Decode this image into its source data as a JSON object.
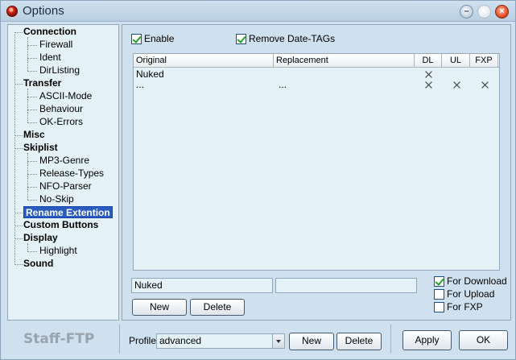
{
  "window": {
    "title": "Options"
  },
  "tree": {
    "items": [
      {
        "label": "Connection",
        "level": 0
      },
      {
        "label": "Firewall",
        "level": 1
      },
      {
        "label": "Ident",
        "level": 1
      },
      {
        "label": "DirListing",
        "level": 1
      },
      {
        "label": "Transfer",
        "level": 0
      },
      {
        "label": "ASCII-Mode",
        "level": 1
      },
      {
        "label": "Behaviour",
        "level": 1
      },
      {
        "label": "OK-Errors",
        "level": 1
      },
      {
        "label": "Misc",
        "level": 0
      },
      {
        "label": "Skiplist",
        "level": 0
      },
      {
        "label": "MP3-Genre",
        "level": 1
      },
      {
        "label": "Release-Types",
        "level": 1
      },
      {
        "label": "NFO-Parser",
        "level": 1
      },
      {
        "label": "No-Skip",
        "level": 1
      },
      {
        "label": "Rename Extention",
        "level": 0,
        "selected": true
      },
      {
        "label": "Custom Buttons",
        "level": 0
      },
      {
        "label": "Display",
        "level": 0
      },
      {
        "label": "Highlight",
        "level": 1
      },
      {
        "label": "Sound",
        "level": 0
      }
    ]
  },
  "options": {
    "enable_label": "Enable",
    "enable_checked": true,
    "remove_date_tags_label": "Remove Date-TAGs",
    "remove_date_tags_checked": true
  },
  "list": {
    "columns": [
      "Original",
      "Replacement",
      "DL",
      "UL",
      "FXP"
    ],
    "rows": [
      {
        "original": "Nuked",
        "replacement": "",
        "dl": true,
        "ul": false,
        "fxp": false
      },
      {
        "original": "...",
        "replacement": "...",
        "dl": true,
        "ul": true,
        "fxp": true
      }
    ]
  },
  "editor": {
    "original_value": "Nuked",
    "replacement_value": "",
    "new_button": "New",
    "delete_button": "Delete",
    "for_download_label": "For Download",
    "for_download_checked": true,
    "for_upload_label": "For Upload",
    "for_upload_checked": false,
    "for_fxp_label": "For FXP",
    "for_fxp_checked": false
  },
  "footer": {
    "logo": "Staff-FTP",
    "profile_label": "Profile",
    "profile_value": "advanced",
    "new_button": "New",
    "delete_button": "Delete",
    "apply_button": "Apply",
    "ok_button": "OK"
  },
  "colors": {
    "selection": "#2a5bbf",
    "panel": "#cfe0ee",
    "field": "#e4f2f7"
  }
}
